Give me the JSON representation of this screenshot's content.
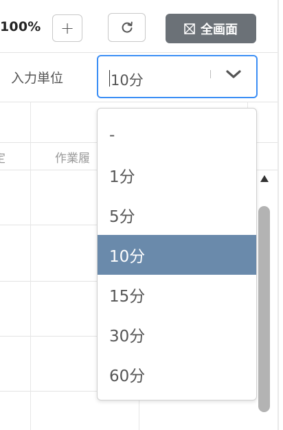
{
  "toolbar": {
    "zoom_value": "100%",
    "zoom_plus": "+",
    "fullscreen_label": "全画面"
  },
  "form": {
    "unit_label": "入力単位",
    "unit_value": "10分"
  },
  "table": {
    "headers_partial": [
      "定",
      "作業履"
    ]
  },
  "dropdown": {
    "options": [
      "-",
      "1分",
      "5分",
      "10分",
      "15分",
      "30分",
      "60分"
    ],
    "selected": "10分"
  },
  "colors": {
    "focus_border": "#3b8ef5",
    "selected_option_bg": "#6a8aab",
    "fullscreen_button_bg": "#6b7177"
  }
}
